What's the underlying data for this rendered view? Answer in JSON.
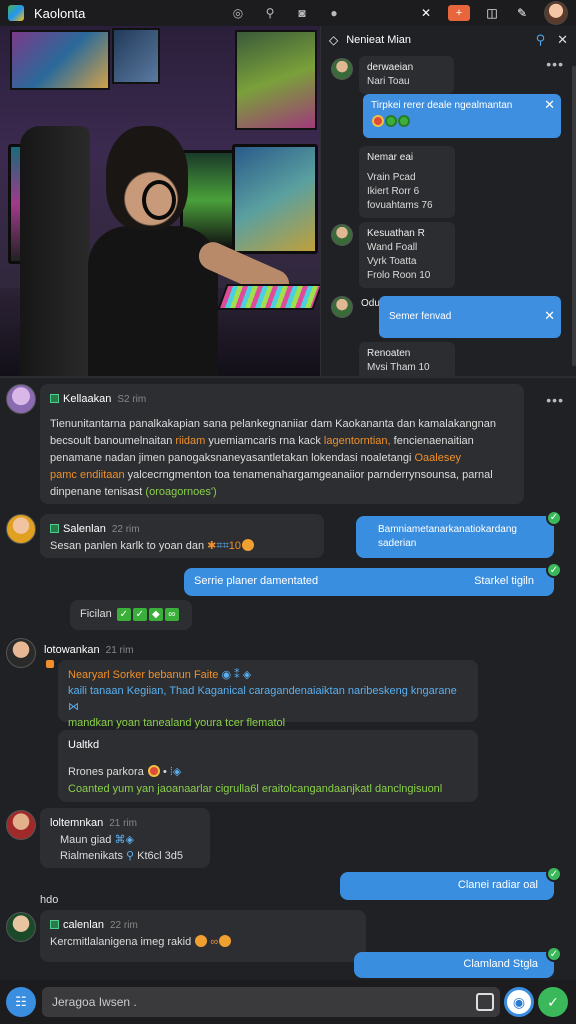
{
  "app": {
    "title": "Kaolonta"
  },
  "topbar": {
    "badge": "+"
  },
  "side": {
    "title": "Nenieat Mian",
    "messages": [
      {
        "name": "derwaeian",
        "line": "Nari Toau"
      },
      {
        "text": "Tirpkei rerer deale ngealmantan"
      },
      {
        "title": "Nemar eai",
        "lines": [
          "Vrain Pcad",
          "Ikiert Rorr 6",
          "fovuahtams   76"
        ]
      },
      {
        "name": "Kesuathan R",
        "lines": [
          "Wand Foall",
          "Vyrk Toatta",
          "Frolo Roon 10"
        ]
      },
      {
        "name": "Odu",
        "text": "Semer fenvad"
      },
      {
        "name": "Renoaten",
        "line": "Mvsi Tham 10"
      }
    ]
  },
  "chat": {
    "m1": {
      "name": "Kellaakan",
      "time": "S2 rim",
      "line1": "Tienunitantarna panalkakapian sana pelankegnaniiar dam Kaokananta dan kamalakangnan",
      "line2a": "becsoult banoumelnaitan ",
      "line2b": "riidam",
      "line2c": " yuemiamcaris rna kack ",
      "line2d": "lagentorntian,",
      "line2e": " fencienaenaitian",
      "line3a": "penamane nadan jimen panogaksnaneyasantletakan lokendasi noaletangi ",
      "line3b": "Oaalesey",
      "line4a": "pamc endiitaan",
      "line4b": " yalcecrngmenton toa tenamenahargamgeanaiior parnderrynsounsa, parnal",
      "line5a": "dinpenane tenisast ",
      "line5b": "(oroagornoes')"
    },
    "m2": {
      "name": "Salenlan",
      "time": "22 rim",
      "text": "Sesan panlen karlk to yoan dan",
      "num": "10"
    },
    "m3": {
      "text": "Bamniametanarkanatiokardang saderian"
    },
    "m4": {
      "left": "Serrie planer damentated",
      "right": "Starkel tigiln"
    },
    "m5": {
      "text": "Ficilan"
    },
    "m6": {
      "name": "lotowankan",
      "time": "21 rim",
      "line1": "Nearyarl Sorker bebanun Faite",
      "line2": "kaili tanaan Kegiian, Thad Kaganical caragandenaiaiktan naribeskeng kngarane",
      "line3": "mandkan yoan tanealand youra tcer flematol"
    },
    "m7": {
      "title": "Ualtkd",
      "line1": "Rrones parkora",
      "line2": "Coanted yum yan jaoanaarlar cigrulla6l eraitolcangandaanjkatl danclngisuonl"
    },
    "m8": {
      "name": "loltemnkan",
      "time": "21 rim",
      "line1": "Maun giad",
      "line2": "Rialmenikats",
      "line2b": "Kt6cl 3d5"
    },
    "m9": {
      "text": "Clanei radiar oal"
    },
    "hdo": "hdo",
    "m10": {
      "name": "calenlan",
      "time": "22 rim",
      "text": "Kercmitlalanigena imeg rakid"
    },
    "m11": {
      "text": "Clamland Stgla"
    }
  },
  "composer": {
    "placeholder": "Jeragoa Iwsen ."
  }
}
